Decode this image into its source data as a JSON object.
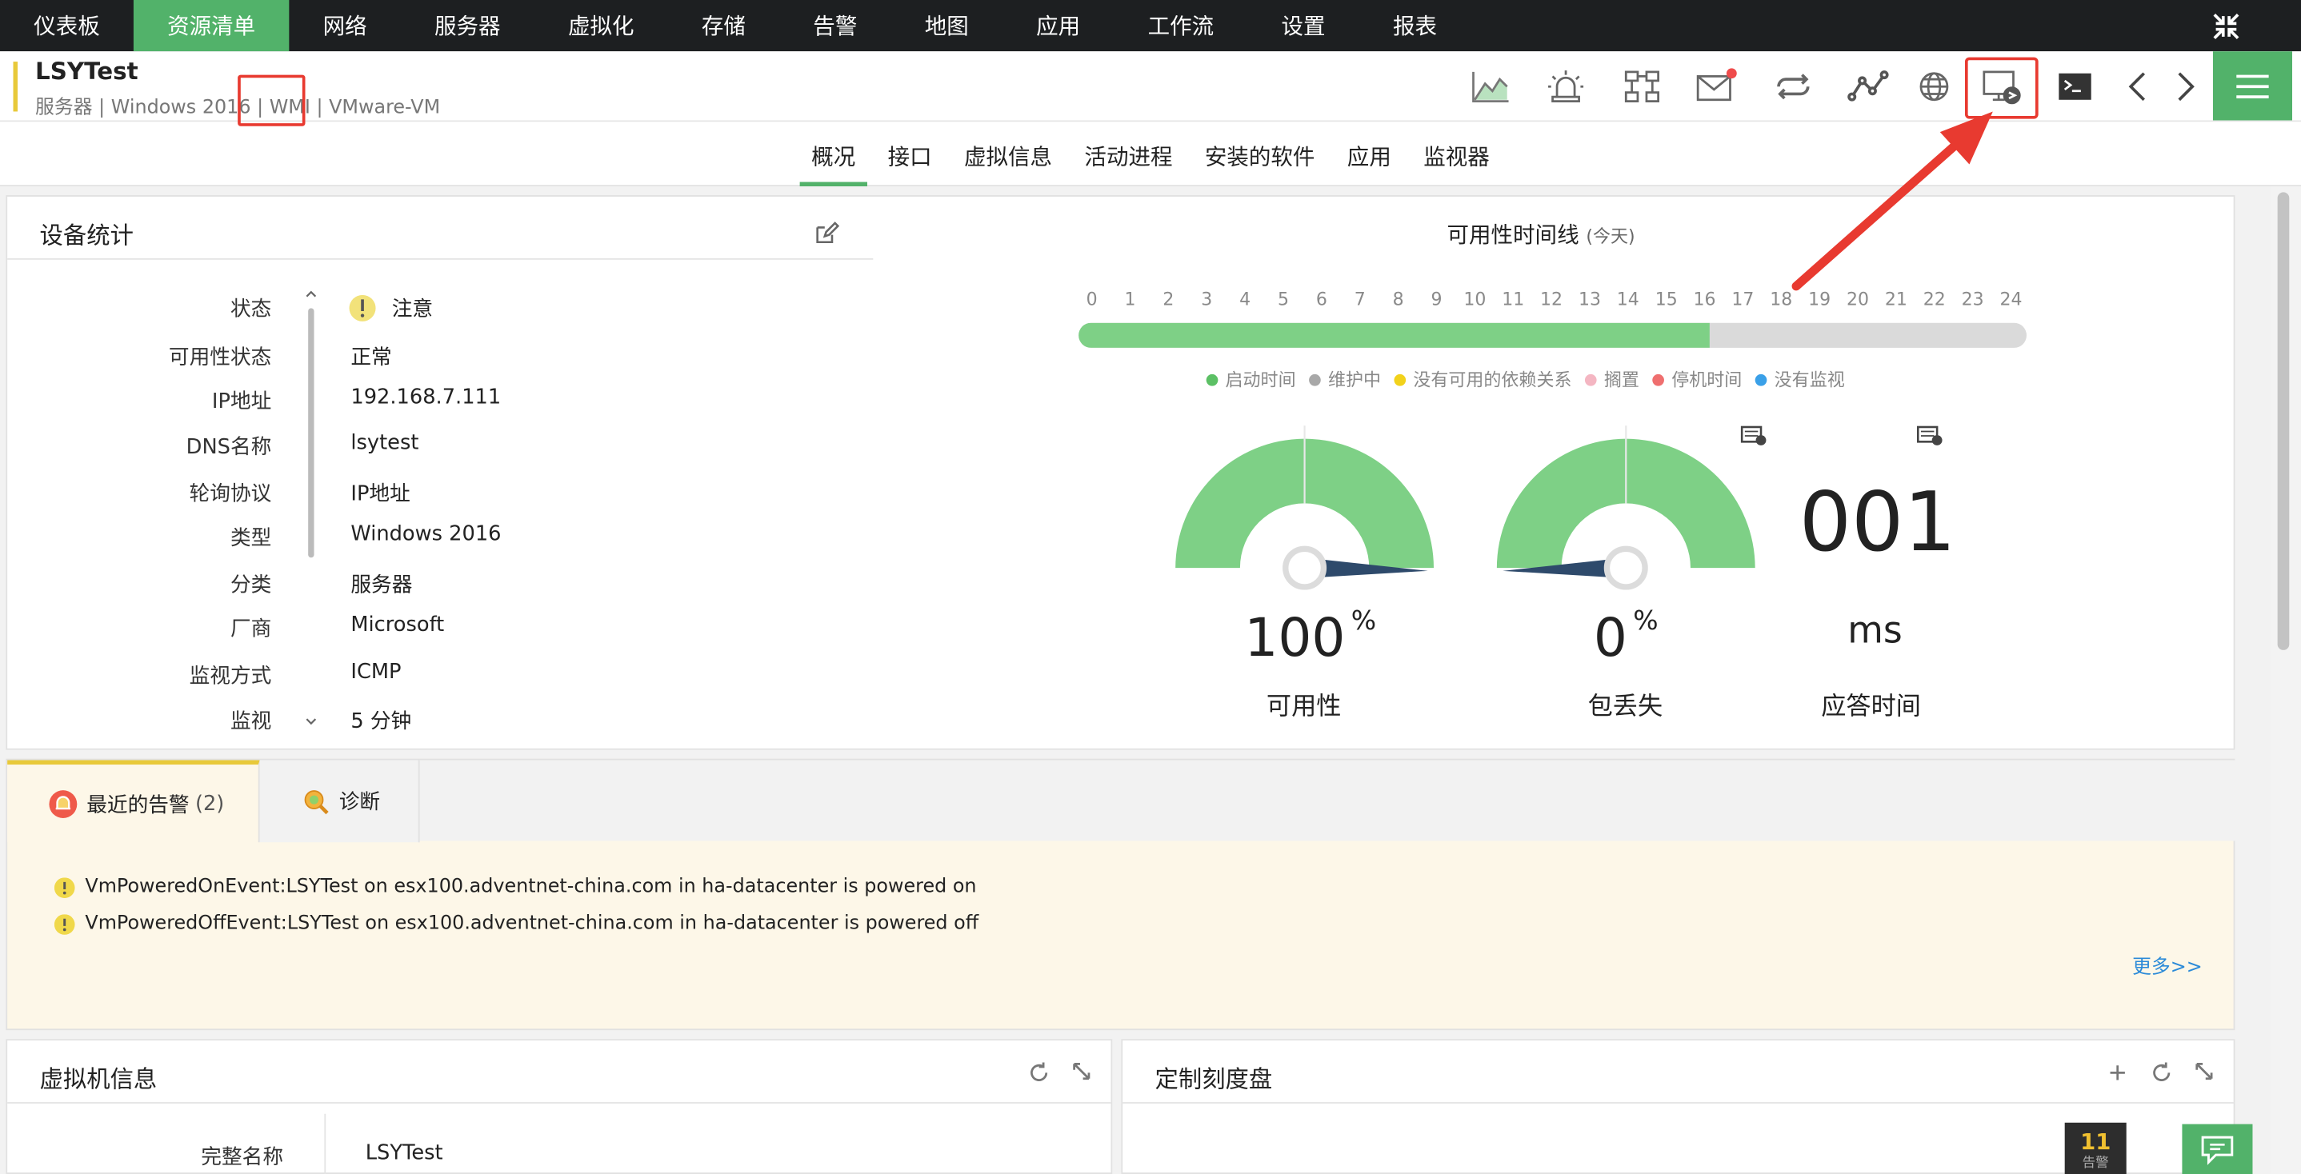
{
  "topnav": {
    "items": [
      "仪表板",
      "资源清单",
      "网络",
      "服务器",
      "虚拟化",
      "存储",
      "告警",
      "地图",
      "应用",
      "工作流",
      "设置",
      "报表"
    ],
    "active_index": 1
  },
  "device": {
    "name": "LSYTest",
    "category": "服务器",
    "os": "Windows 2016",
    "protocol": "WMI",
    "type": "VMware-VM",
    "separator": " | "
  },
  "subtabs": {
    "items": [
      "概况",
      "接口",
      "虚拟信息",
      "活动进程",
      "安装的软件",
      "应用",
      "监视器"
    ],
    "active_index": 0
  },
  "stats": {
    "title": "设备统计",
    "rows": [
      {
        "label": "状态",
        "value": "注意"
      },
      {
        "label": "可用性状态",
        "value": "正常"
      },
      {
        "label": "IP地址",
        "value": "192.168.7.111"
      },
      {
        "label": "DNS名称",
        "value": "lsytest"
      },
      {
        "label": "轮询协议",
        "value": "IP地址"
      },
      {
        "label": "类型",
        "value": "Windows 2016"
      },
      {
        "label": "分类",
        "value": "服务器"
      },
      {
        "label": "厂商",
        "value": "Microsoft"
      },
      {
        "label": "监视方式",
        "value": "ICMP"
      },
      {
        "label": "监视",
        "value": "5 分钟"
      }
    ]
  },
  "timeline": {
    "title": "可用性时间线",
    "period": "(今天)",
    "hours": [
      "0",
      "1",
      "2",
      "3",
      "4",
      "5",
      "6",
      "7",
      "8",
      "9",
      "10",
      "11",
      "12",
      "13",
      "14",
      "15",
      "16",
      "17",
      "18",
      "19",
      "20",
      "21",
      "22",
      "23",
      "24"
    ],
    "uptime_fraction": 0.665,
    "legend": [
      {
        "label": "启动时间",
        "color": "#5cc065"
      },
      {
        "label": "维护中",
        "color": "#a8a8a8"
      },
      {
        "label": "没有可用的依赖关系",
        "color": "#f2d21b"
      },
      {
        "label": "搁置",
        "color": "#f4b6c2"
      },
      {
        "label": "停机时间",
        "color": "#ef6f6f"
      },
      {
        "label": "没有监视",
        "color": "#3aa0e8"
      }
    ]
  },
  "gauges": [
    {
      "value": "100",
      "unit": "%",
      "label": "可用性",
      "level": 1.0
    },
    {
      "value": "0",
      "unit": "%",
      "label": "包丢失",
      "level": 0.0
    }
  ],
  "response": {
    "value": "001",
    "unit": "ms",
    "label": "应答时间"
  },
  "alerts": {
    "tab_label": "最近的告警",
    "tab_count": "(2)",
    "diag_label": "诊断",
    "items": [
      "VmPoweredOnEvent:LSYTest on esx100.adventnet-china.com in ha-datacenter is powered on",
      "VmPoweredOffEvent:LSYTest on esx100.adventnet-china.com in ha-datacenter is powered off"
    ],
    "more": "更多>>"
  },
  "vminfo": {
    "title": "虚拟机信息",
    "first_label": "完整名称",
    "first_value": "LSYTest"
  },
  "custom": {
    "title": "定制刻度盘"
  },
  "badge": {
    "count": "11",
    "label": "告警"
  },
  "colors": {
    "accent_green": "#52b26a",
    "nav_bg": "#1d1f21",
    "annotation_red": "#e83a30",
    "gauge_green": "#7ed086",
    "needle": "#2e4a6b"
  }
}
